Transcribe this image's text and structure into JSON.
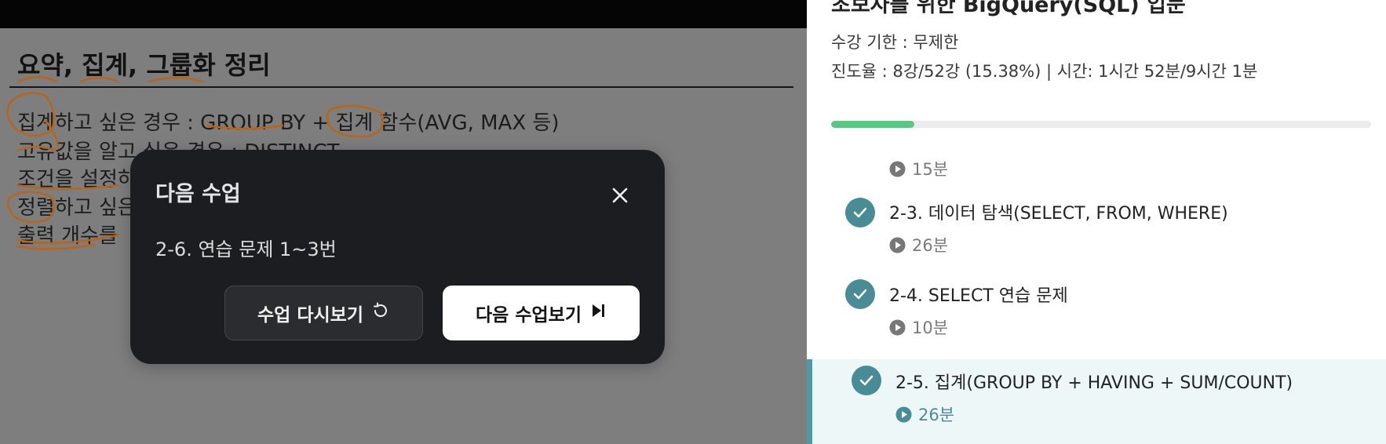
{
  "slide": {
    "title": "요약, 집계, 그룹화 정리",
    "lines": [
      "집계하고 싶은 경우 : GROUP BY + 집계 함수(AVG, MAX 등)",
      "고유값을 알고 싶은 경우 : DISTINCT",
      "조건을 설정하",
      "정렬하고 싶은",
      "출력 개수를 "
    ],
    "annotation_color": "#b8651a"
  },
  "modal": {
    "title": "다음 수업",
    "close_icon": "close-icon",
    "lesson": "2-6. 연습 문제 1~3번",
    "replay_label": "수업 다시보기",
    "replay_icon": "replay-icon",
    "next_label": "다음 수업보기",
    "next_icon": "skip-next-icon"
  },
  "panel": {
    "course_title": "초보자를 위한 BigQuery(SQL) 입문",
    "period": "수강 기한 : 무제한",
    "progress_text": "진도율 : 8강/52강 (15.38%) | 시간: 1시간 52분/9시간 1분",
    "progress_percent": 15.38,
    "progress_color": "#5cc484",
    "partial_duration": "15분",
    "lessons": [
      {
        "title": "2-3. 데이터 탐색(SELECT, FROM, WHERE)",
        "duration": "26분",
        "done": true,
        "active": false
      },
      {
        "title": "2-4. SELECT 연습 문제",
        "duration": "10분",
        "done": true,
        "active": false
      },
      {
        "title": "2-5. 집계(GROUP BY + HAVING + SUM/COUNT)",
        "duration": "26분",
        "done": true,
        "active": true
      }
    ],
    "accent_color": "#4a8c96"
  }
}
